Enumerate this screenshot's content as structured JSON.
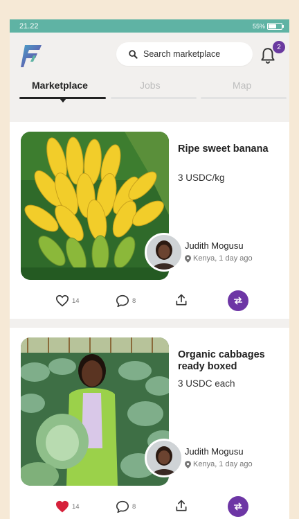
{
  "status_bar": {
    "time": "21.22",
    "battery": "55%",
    "battery_level": 0.55
  },
  "header": {
    "search_placeholder": "Search marketplace",
    "notification_count": "2"
  },
  "tabs": [
    {
      "label": "Marketplace"
    },
    {
      "label": "Jobs"
    },
    {
      "label": "Map"
    }
  ],
  "posts": [
    {
      "title": "Ripe sweet banana",
      "price": "3 USDC/kg",
      "seller": "Judith Mogusu",
      "location": "Kenya, 1 day ago",
      "likes": "14",
      "comments": "8",
      "liked": false
    },
    {
      "title": "Organic cabbages ready boxed",
      "price": "3 USDC each",
      "seller": "Judith Mogusu",
      "location": "Kenya, 1 day ago",
      "likes": "14",
      "comments": "8",
      "liked": true
    }
  ],
  "colors": {
    "status_bar": "#5fb3a4",
    "accent_purple": "#6d36a5",
    "liked_heart": "#d6213b",
    "background": "#f6e9d6"
  }
}
